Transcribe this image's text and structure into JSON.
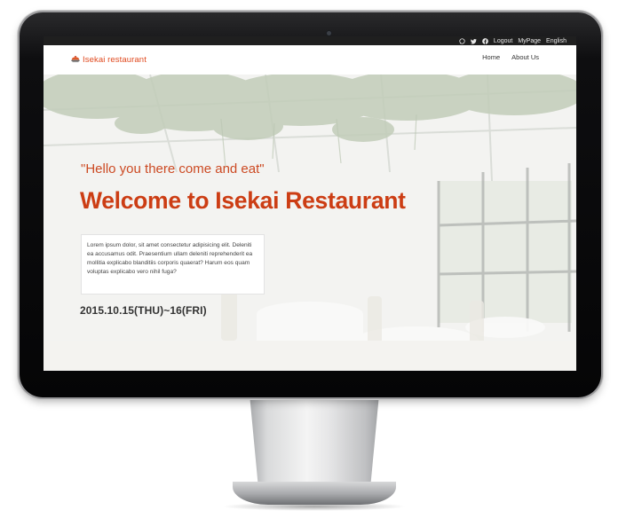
{
  "topbar": {
    "logout_label": "Logout",
    "mypage_label": "MyPage",
    "language_label": "English"
  },
  "navbar": {
    "brand_name": "Isekai restaurant",
    "links": [
      "Home",
      "About Us"
    ]
  },
  "hero": {
    "tagline": "\"Hello you there come and eat\"",
    "headline": "Welcome to Isekai Restaurant",
    "description": "Lorem ipsum dolor, sit amet consectetur adipisicing elit. Deleniti ea accusamus odit. Praesentium ullam deleniti reprehenderit ea mollitia explicabo blanditiis corporis quaerat? Harum eos quam voluptas explicabo vero nihil fuga?",
    "date": "2015.10.15(THU)~16(FRI)"
  },
  "colors": {
    "brand": "#e04a1f",
    "headline": "#cc3d14",
    "topbar_bg": "#1f1f1f"
  },
  "icons": [
    "whatsapp-icon",
    "twitter-icon",
    "facebook-icon",
    "restaurant-logo-icon",
    "webcam-icon"
  ]
}
